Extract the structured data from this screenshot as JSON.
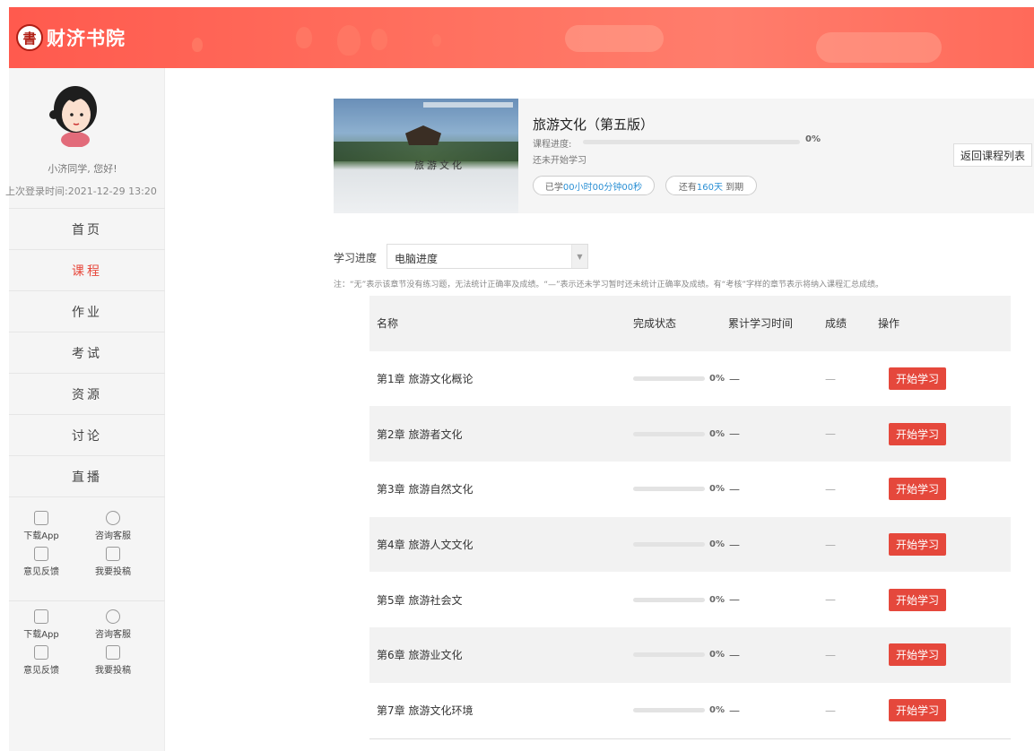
{
  "header": {
    "logo_mark": "書",
    "logo_text": "财济书院"
  },
  "sidebar": {
    "greeting": "小济同学, 您好!",
    "last_login": "上次登录时间:2021-12-29 13:20",
    "menu": [
      {
        "label": "首页",
        "active": false
      },
      {
        "label": "课程",
        "active": true
      },
      {
        "label": "作业",
        "active": false
      },
      {
        "label": "考试",
        "active": false
      },
      {
        "label": "资源",
        "active": false
      },
      {
        "label": "讨论",
        "active": false
      },
      {
        "label": "直播",
        "active": false
      }
    ],
    "tools_group1": [
      {
        "label": "下载App",
        "icon": "phone-icon"
      },
      {
        "label": "咨询客服",
        "icon": "headset-icon"
      },
      {
        "label": "意见反馈",
        "icon": "feedback-icon"
      },
      {
        "label": "我要投稿",
        "icon": "document-icon"
      }
    ],
    "tools_group2": [
      {
        "label": "下载App",
        "icon": "phone-icon"
      },
      {
        "label": "咨询客服",
        "icon": "headset-icon"
      },
      {
        "label": "意见反馈",
        "icon": "feedback-icon"
      },
      {
        "label": "我要投稿",
        "icon": "document-icon"
      }
    ]
  },
  "course": {
    "title": "旅游文化（第五版）",
    "progress_label": "课程进度:",
    "progress_percent": "0%",
    "progress_value": 0,
    "status": "还未开始学习",
    "studied_prefix": "已学",
    "studied_time": "00小时00分钟00秒",
    "remaining_prefix": "还有",
    "remaining_days": "160天",
    "remaining_suffix": "到期",
    "cover_title": "旅游文化",
    "back_button": "返回课程列表"
  },
  "progress_select": {
    "label": "学习进度",
    "value": "电脑进度"
  },
  "note": "注：“无”表示该章节没有练习题，无法统计正确率及成绩。“—”表示还未学习暂时还未统计正确率及成绩。有“考核”字样的章节表示将纳入课程汇总成绩。",
  "table": {
    "headers": {
      "name": "名称",
      "status": "完成状态",
      "time": "累计学习时间",
      "score": "成绩",
      "op": "操作"
    },
    "rows": [
      {
        "name": "第1章  旅游文化概论",
        "progress": 0,
        "percent": "0%",
        "time": "—",
        "score": "—",
        "action": "开始学习"
      },
      {
        "name": "第2章  旅游者文化",
        "progress": 0,
        "percent": "0%",
        "time": "—",
        "score": "—",
        "action": "开始学习"
      },
      {
        "name": "第3章  旅游自然文化",
        "progress": 0,
        "percent": "0%",
        "time": "—",
        "score": "—",
        "action": "开始学习"
      },
      {
        "name": "第4章  旅游人文文化",
        "progress": 0,
        "percent": "0%",
        "time": "—",
        "score": "—",
        "action": "开始学习"
      },
      {
        "name": "第5章  旅游社会文",
        "progress": 0,
        "percent": "0%",
        "time": "—",
        "score": "—",
        "action": "开始学习"
      },
      {
        "name": "第6章  旅游业文化",
        "progress": 0,
        "percent": "0%",
        "time": "—",
        "score": "—",
        "action": "开始学习"
      },
      {
        "name": "第7章  旅游文化环境",
        "progress": 0,
        "percent": "0%",
        "time": "—",
        "score": "—",
        "action": "开始学习"
      }
    ]
  },
  "colors": {
    "brand": "#ff5a4e",
    "accent_red": "#e5483c",
    "progress_blue": "#3aa0e8",
    "highlight_blue": "#2a8fd4"
  }
}
